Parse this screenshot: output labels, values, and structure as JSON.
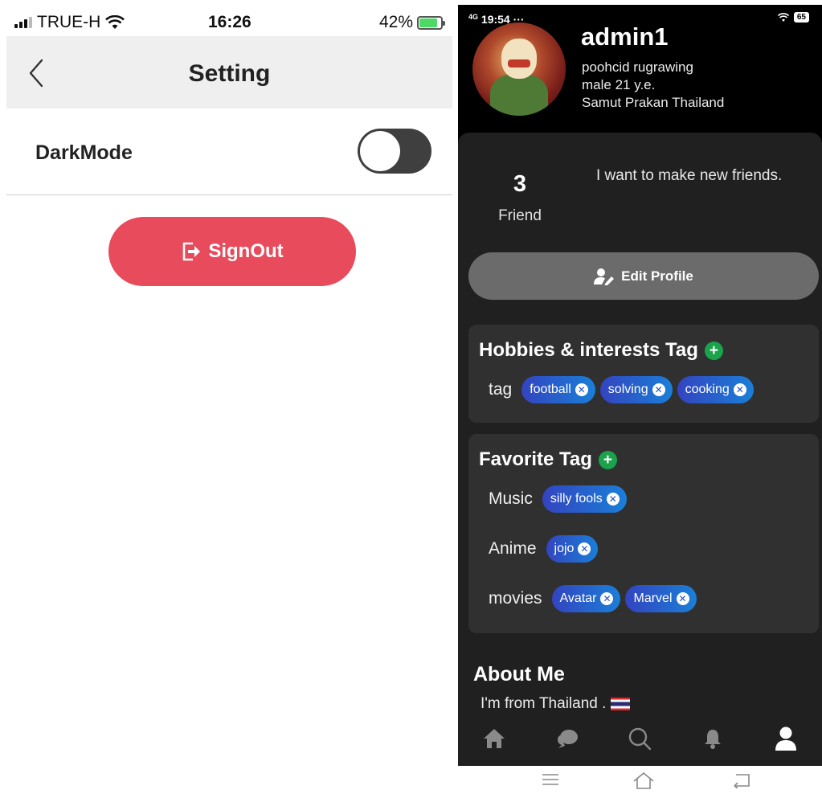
{
  "left_screen": {
    "status": {
      "carrier": "TRUE-H",
      "time": "16:26",
      "battery": "42%"
    },
    "nav": {
      "title": "Setting"
    },
    "settings": {
      "darkmode_label": "DarkMode",
      "darkmode_on": false
    },
    "signout_label": "SignOut",
    "colors": {
      "signout": "#e84b5b",
      "toggle_track": "#3f3f3f",
      "nav_bg": "#efefef"
    }
  },
  "right_screen": {
    "status": {
      "time": "19:54 ···",
      "signal": "4G",
      "battery": "65"
    },
    "profile": {
      "username": "admin1",
      "full_name": "poohcid rugrawing",
      "age_gender": "male 21 y.e.",
      "location": "Samut Prakan Thailand"
    },
    "stats": {
      "friend_count": "3",
      "friend_label": "Friend"
    },
    "bio": "I want to make new friends.",
    "edit_profile_label": "Edit Profile",
    "hobbies": {
      "title": "Hobbies & interests Tag",
      "label": "tag",
      "tags": [
        "football",
        "solving",
        "cooking"
      ]
    },
    "favorites": {
      "title": "Favorite Tag",
      "groups": [
        {
          "label": "Music",
          "tags": [
            "silly fools"
          ]
        },
        {
          "label": "Anime",
          "tags": [
            "jojo"
          ]
        },
        {
          "label": "movies",
          "tags": [
            "Avatar",
            "Marvel"
          ]
        }
      ]
    },
    "about": {
      "title": "About Me",
      "text": "I'm from Thailand ."
    },
    "tabbar": [
      "home-icon",
      "chat-icon",
      "search-icon",
      "bell-icon",
      "profile-icon"
    ],
    "colors": {
      "sheet": "#202020",
      "card": "#303030",
      "chip_start": "#3344c0",
      "chip_end": "#1a7fd8",
      "plus": "#1aa34a"
    }
  }
}
